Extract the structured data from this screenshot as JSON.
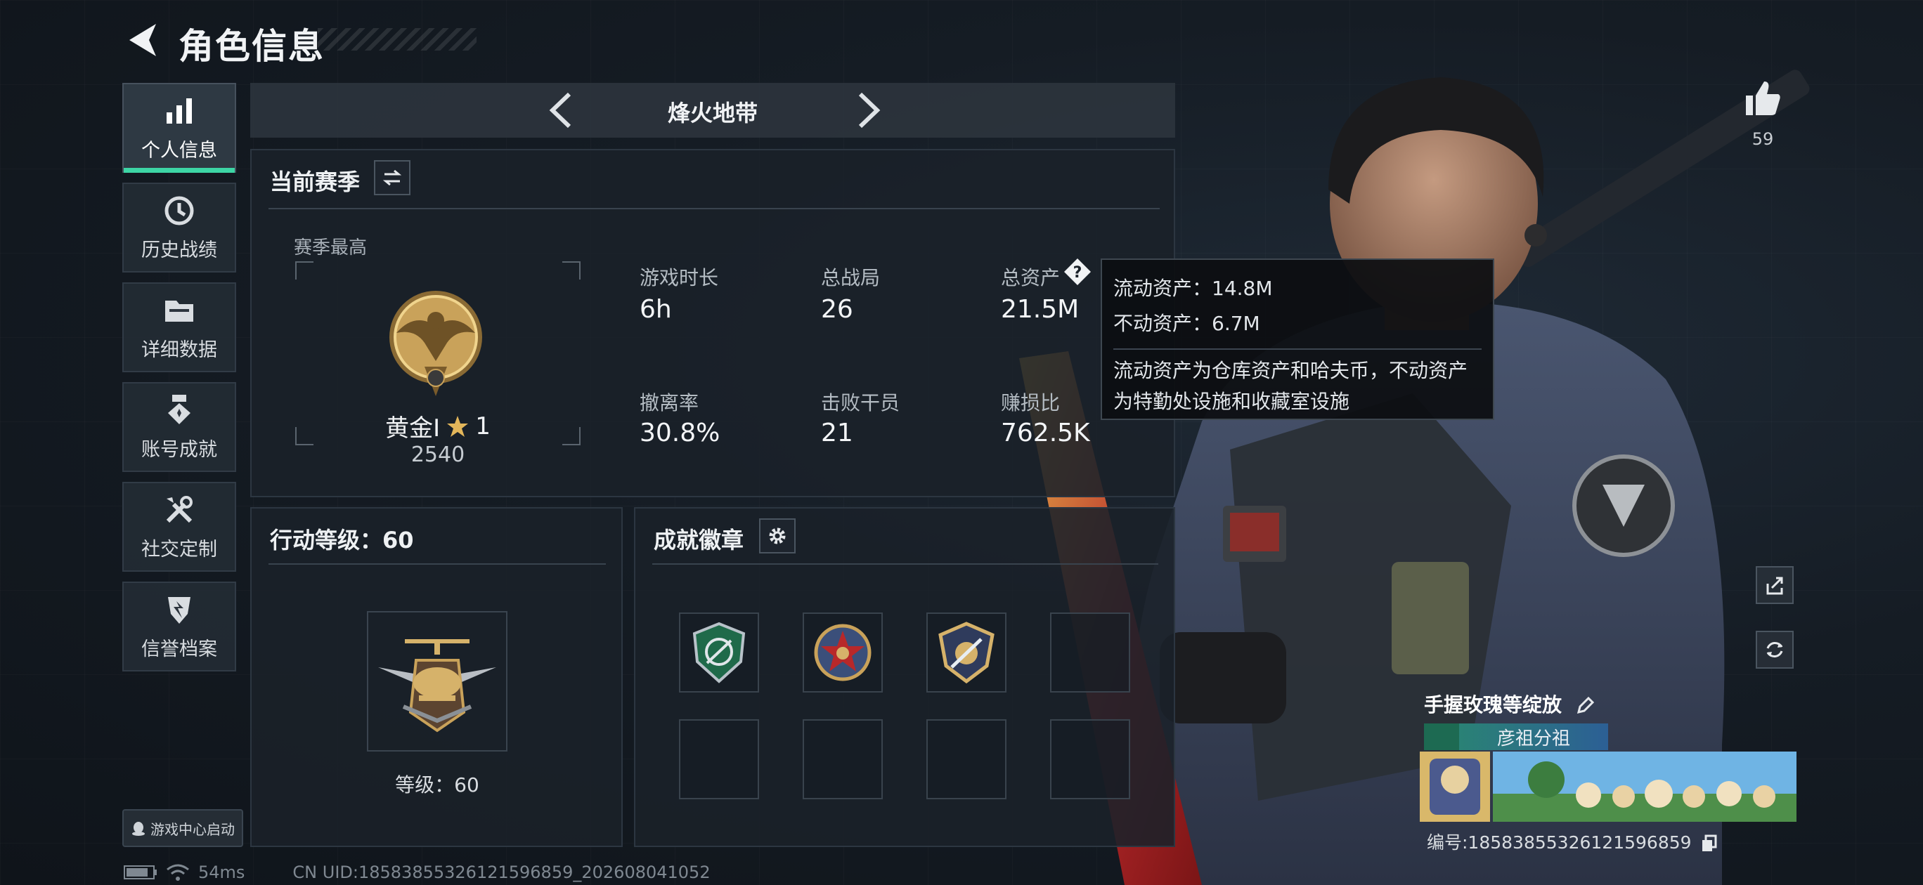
{
  "header": {
    "title": "角色信息"
  },
  "sidebar": {
    "items": [
      {
        "label": "个人信息",
        "icon": "bar-chart-icon",
        "active": true
      },
      {
        "label": "历史战绩",
        "icon": "clock-icon",
        "active": false
      },
      {
        "label": "详细数据",
        "icon": "folder-icon",
        "active": false
      },
      {
        "label": "账号成就",
        "icon": "medal-icon",
        "active": false
      },
      {
        "label": "社交定制",
        "icon": "tools-icon",
        "active": false
      },
      {
        "label": "信誉档案",
        "icon": "shield-icon",
        "active": false
      }
    ],
    "launch_label": "游戏中心启动"
  },
  "mode": {
    "title": "烽火地带"
  },
  "season": {
    "title": "当前赛季",
    "best_label": "赛季最高",
    "rank_name": "黄金I",
    "rank_stars": "1",
    "rank_score": "2540",
    "stats": [
      {
        "label": "游戏时长",
        "value": "6h"
      },
      {
        "label": "总战局",
        "value": "26"
      },
      {
        "label": "总资产",
        "value": "21.5M"
      },
      {
        "label": "撤离率",
        "value": "30.8%"
      },
      {
        "label": "击败干员",
        "value": "21"
      },
      {
        "label": "赚损比",
        "value": "762.5K"
      }
    ]
  },
  "tooltip": {
    "liquid": "流动资产：14.8M",
    "fixed": "不动资产：6.7M",
    "desc_line1": "流动资产为仓库资产和哈夫币，不动资产",
    "desc_line2": "为特勤处设施和收藏室设施"
  },
  "action_level": {
    "title": "行动等级：60",
    "level_text": "等级：60"
  },
  "achievements": {
    "title": "成就徽章"
  },
  "profile": {
    "likes": "59",
    "name": "手握玫瑰等绽放",
    "team": "彦祖分祖",
    "id_text": "编号:18583855326121596859",
    "uid_text": "CN UID:18583855326121596859_202608041052",
    "ping": "54ms"
  },
  "colors": {
    "accent": "#3dd5a5",
    "gold": "#c9a25a"
  }
}
